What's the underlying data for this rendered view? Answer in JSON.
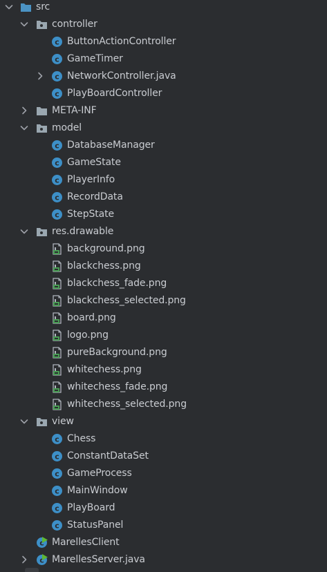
{
  "tree": [
    {
      "label": "src",
      "depth": 0,
      "kind": "source-folder",
      "chevron": "down"
    },
    {
      "label": "controller",
      "depth": 1,
      "kind": "package",
      "chevron": "down"
    },
    {
      "label": "ButtonActionController",
      "depth": 2,
      "kind": "class"
    },
    {
      "label": "GameTimer",
      "depth": 2,
      "kind": "class"
    },
    {
      "label": "NetworkController.java",
      "depth": 2,
      "kind": "class",
      "chevron": "right"
    },
    {
      "label": "PlayBoardController",
      "depth": 2,
      "kind": "class"
    },
    {
      "label": "META-INF",
      "depth": 1,
      "kind": "folder",
      "chevron": "right"
    },
    {
      "label": "model",
      "depth": 1,
      "kind": "package",
      "chevron": "down"
    },
    {
      "label": "DatabaseManager",
      "depth": 2,
      "kind": "class"
    },
    {
      "label": "GameState",
      "depth": 2,
      "kind": "class"
    },
    {
      "label": "PlayerInfo",
      "depth": 2,
      "kind": "class"
    },
    {
      "label": "RecordData",
      "depth": 2,
      "kind": "class"
    },
    {
      "label": "StepState",
      "depth": 2,
      "kind": "class"
    },
    {
      "label": "res.drawable",
      "depth": 1,
      "kind": "package",
      "chevron": "down"
    },
    {
      "label": "background.png",
      "depth": 2,
      "kind": "image-file"
    },
    {
      "label": "blackchess.png",
      "depth": 2,
      "kind": "image-file"
    },
    {
      "label": "blackchess_fade.png",
      "depth": 2,
      "kind": "image-file"
    },
    {
      "label": "blackchess_selected.png",
      "depth": 2,
      "kind": "image-file"
    },
    {
      "label": "board.png",
      "depth": 2,
      "kind": "image-file"
    },
    {
      "label": "logo.png",
      "depth": 2,
      "kind": "image-file"
    },
    {
      "label": "pureBackground.png",
      "depth": 2,
      "kind": "image-file"
    },
    {
      "label": "whitechess.png",
      "depth": 2,
      "kind": "image-file"
    },
    {
      "label": "whitechess_fade.png",
      "depth": 2,
      "kind": "image-file"
    },
    {
      "label": "whitechess_selected.png",
      "depth": 2,
      "kind": "image-file"
    },
    {
      "label": "view",
      "depth": 1,
      "kind": "package",
      "chevron": "down"
    },
    {
      "label": "Chess",
      "depth": 2,
      "kind": "class"
    },
    {
      "label": "ConstantDataSet",
      "depth": 2,
      "kind": "class"
    },
    {
      "label": "GameProcess",
      "depth": 2,
      "kind": "class"
    },
    {
      "label": "MainWindow",
      "depth": 2,
      "kind": "class"
    },
    {
      "label": "PlayBoard",
      "depth": 2,
      "kind": "class"
    },
    {
      "label": "StatusPanel",
      "depth": 2,
      "kind": "class"
    },
    {
      "label": "MarellesClient",
      "depth": 1,
      "kind": "main-class"
    },
    {
      "label": "MarellesServer.java",
      "depth": 1,
      "kind": "main-class",
      "chevron": "right"
    }
  ],
  "colors": {
    "background": "#2b2d30",
    "text": "#c9ccd1",
    "chevron": "#9da0a8",
    "folder": "#9aa7b0",
    "source_folder": "#4b93c4",
    "class_icon": "#3d8fc7",
    "class_letter": "#2b2d30",
    "main_badge": "#5fb832",
    "image_file_body": "#aeb4bc",
    "image_file_badge": "#499c54"
  },
  "icons": {
    "source-folder": "source-folder-icon",
    "package": "package-icon",
    "folder": "folder-icon",
    "class": "class-icon",
    "main-class": "main-class-icon",
    "image-file": "image-file-icon",
    "down": "chevron-down-icon",
    "right": "chevron-right-icon"
  }
}
